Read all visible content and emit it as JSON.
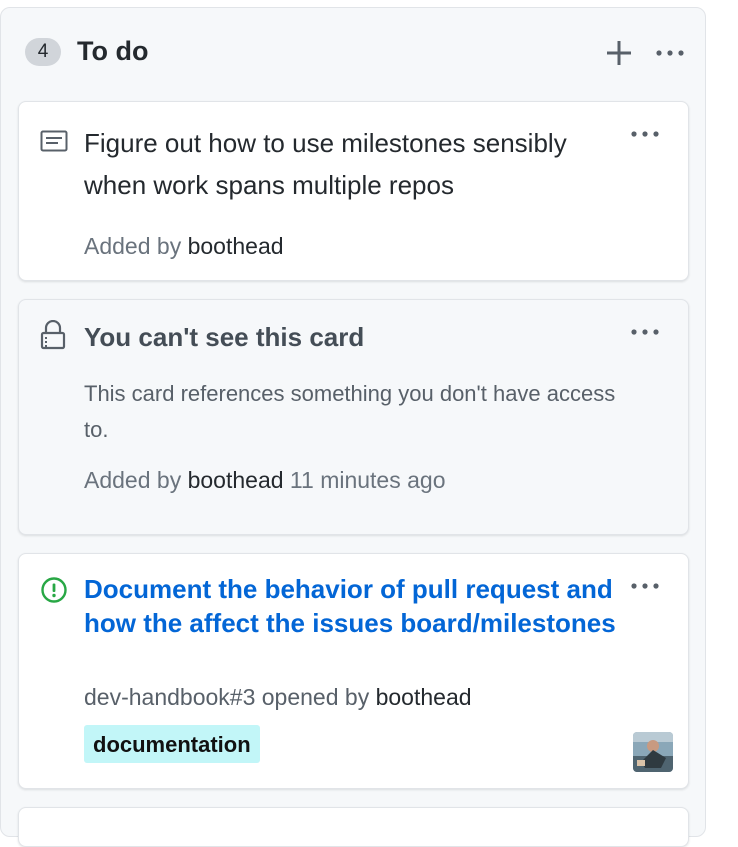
{
  "column": {
    "count": "4",
    "title": "To do",
    "add_icon": "plus-icon",
    "more_icon": "kebab-horizontal-icon"
  },
  "cards": [
    {
      "type": "note",
      "icon": "note-icon",
      "text": "Figure out how to use milestones sensibly when work spans multiple repos",
      "added_by_prefix": "Added by",
      "added_by_user": "boothead"
    },
    {
      "type": "locked",
      "icon": "lock-icon",
      "title": "You can't see this card",
      "description": "This card references something you don't have access to.",
      "added_by_prefix": "Added by",
      "added_by_user": "boothead",
      "added_time": "11 minutes ago"
    },
    {
      "type": "issue",
      "icon": "issue-opened-icon",
      "title": "Document the behavior of pull request and how the affect the issues board/milestones",
      "reference": "dev-handbook#3",
      "opened_by_prefix": "opened by",
      "opened_by_user": "boothead",
      "label": "documentation",
      "label_color": "#c2f6f8",
      "assignee_avatar": "avatar"
    }
  ],
  "colors": {
    "link": "#0366d6",
    "issue_open": "#28a745",
    "column_bg": "#f6f8fa"
  }
}
